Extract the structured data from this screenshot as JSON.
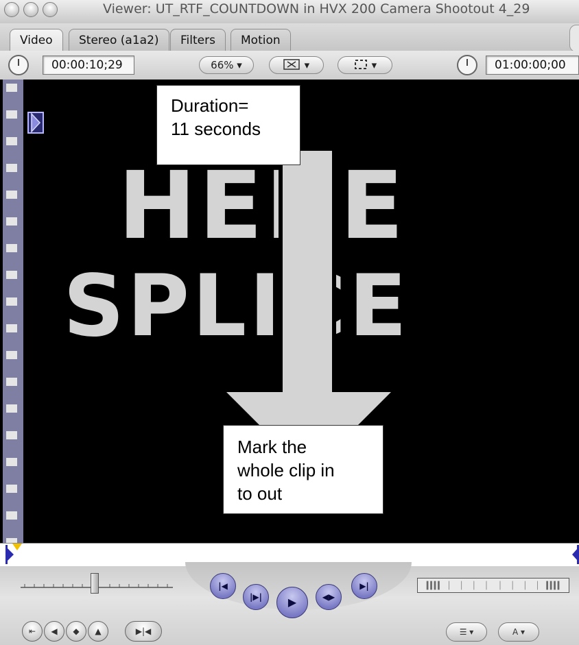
{
  "window": {
    "title": "Viewer: UT_RTF_COUNTDOWN in HVX 200 Camera Shootout 4_29"
  },
  "tabs": [
    {
      "label": "Video",
      "active": true
    },
    {
      "label": "Stereo (a1a2)",
      "active": false
    },
    {
      "label": "Filters",
      "active": false
    },
    {
      "label": "Motion",
      "active": false
    }
  ],
  "controls": {
    "duration_timecode": "00:00:10;29",
    "zoom": "66%",
    "view_menu_icon": "film-view-icon",
    "display_menu_icon": "overlay-icon",
    "current_timecode": "01:00:00;00"
  },
  "frame": {
    "line1": "HERE",
    "line2": "SPLICE",
    "arrow": "down-arrow"
  },
  "callouts": {
    "duration": [
      "Duration=",
      "11 seconds"
    ],
    "mark": [
      "Mark the",
      "whole clip in",
      "to out"
    ]
  },
  "colors": {
    "canvas": "#000000",
    "frame_art": "#d4d4d4",
    "filmstrip": "#7f7fa4",
    "transport_button": "#7878c4",
    "playhead": "#f2c200"
  },
  "transport": {
    "buttons": [
      "previous-edit-icon",
      "play-in-to-out-icon",
      "play-icon",
      "play-around-current-icon",
      "next-edit-icon"
    ],
    "bottom_buttons": [
      "match-frame-icon",
      "mark-in-icon",
      "add-marker-icon",
      "mark-clip-icon",
      "mark-in-out-icon"
    ],
    "popups": [
      "recent-clips-icon",
      "generator-icon"
    ]
  }
}
